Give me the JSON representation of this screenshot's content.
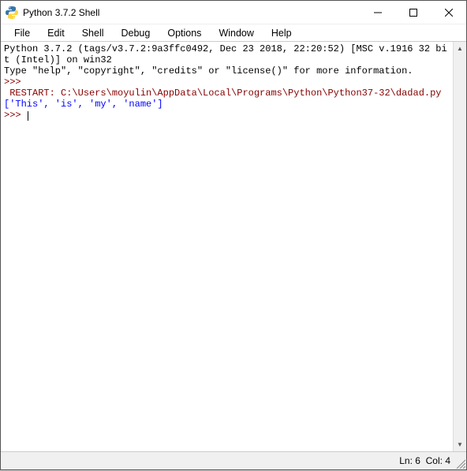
{
  "window": {
    "title": "Python 3.7.2 Shell"
  },
  "menu": {
    "items": [
      "File",
      "Edit",
      "Shell",
      "Debug",
      "Options",
      "Window",
      "Help"
    ]
  },
  "shell": {
    "banner1": "Python 3.7.2 (tags/v3.7.2:9a3ffc0492, Dec 23 2018, 22:20:52) [MSC v.1916 32 bit (Intel)] on win32",
    "banner2": "Type \"help\", \"copyright\", \"credits\" or \"license()\" for more information.",
    "prompt1": ">>> ",
    "restart": " RESTART: C:\\Users\\moyulin\\AppData\\Local\\Programs\\Python\\Python37-32\\dadad.py ",
    "output": "['This', 'is', 'my', 'name']",
    "prompt2": ">>> "
  },
  "status": {
    "ln_label": "Ln: ",
    "ln": "6",
    "col_label": "Col: ",
    "col": "4"
  }
}
